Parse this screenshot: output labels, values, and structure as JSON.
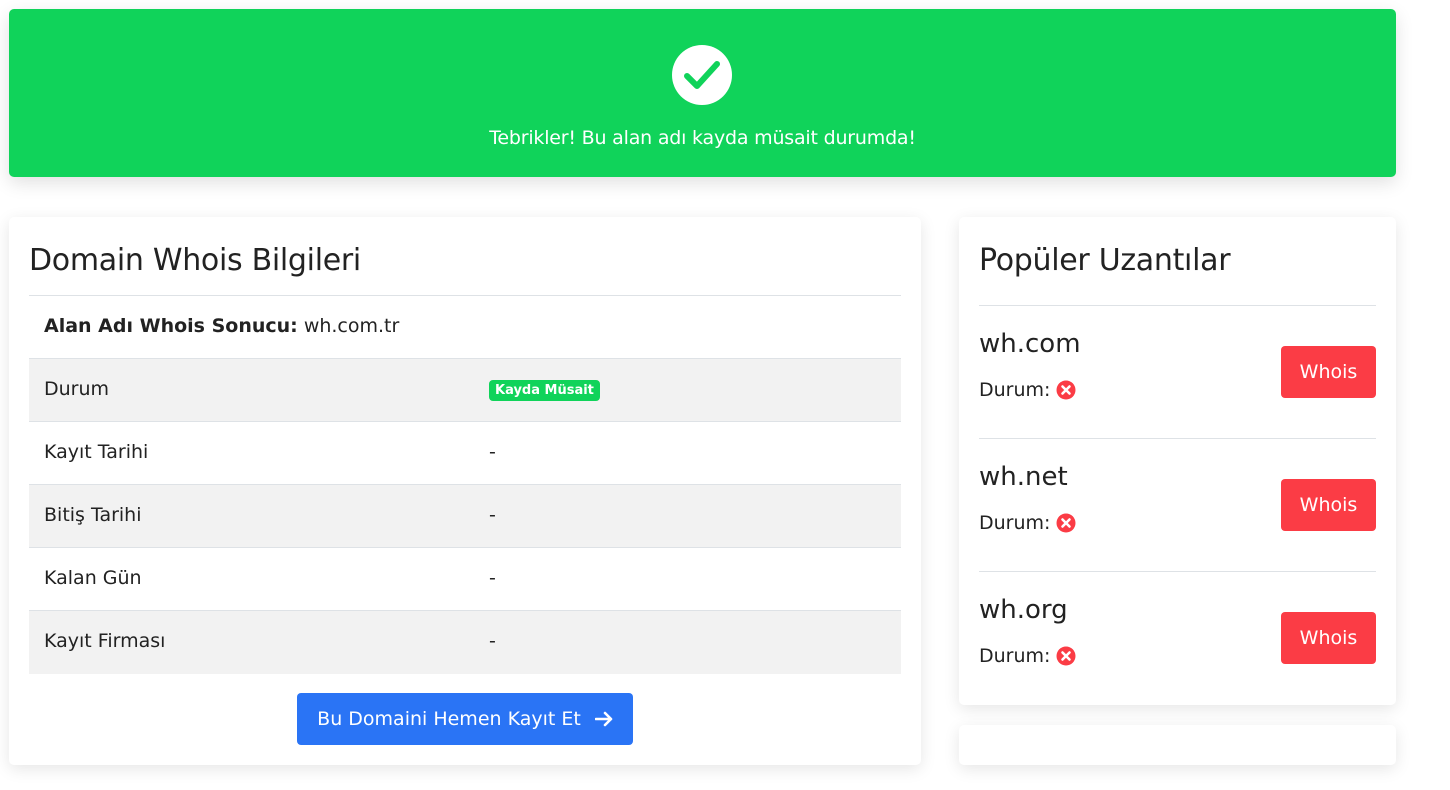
{
  "alert": {
    "message": "Tebrikler! Bu alan adı kayda müsait durumda!",
    "icon": "check-circle-icon",
    "color": "#10d35a"
  },
  "whois": {
    "title": "Domain Whois Bilgileri",
    "result_label": "Alan Adı Whois Sonucu:",
    "result_value": "wh.com.tr",
    "rows": [
      {
        "label": "Durum",
        "value": "Kayda Müsait",
        "badge": true
      },
      {
        "label": "Kayıt Tarihi",
        "value": "-"
      },
      {
        "label": "Bitiş Tarihi",
        "value": "-"
      },
      {
        "label": "Kalan Gün",
        "value": "-"
      },
      {
        "label": "Kayıt Firması",
        "value": "-"
      }
    ],
    "register_button": "Bu Domaini Hemen Kayıt Et",
    "register_button_color": "#2a74f5"
  },
  "popular": {
    "title": "Popüler Uzantılar",
    "status_label": "Durum:",
    "button_label": "Whois",
    "button_color": "#fb3c45",
    "items": [
      {
        "domain": "wh.com",
        "status_icon": "x-circle-icon"
      },
      {
        "domain": "wh.net",
        "status_icon": "x-circle-icon"
      },
      {
        "domain": "wh.org",
        "status_icon": "x-circle-icon"
      }
    ]
  }
}
